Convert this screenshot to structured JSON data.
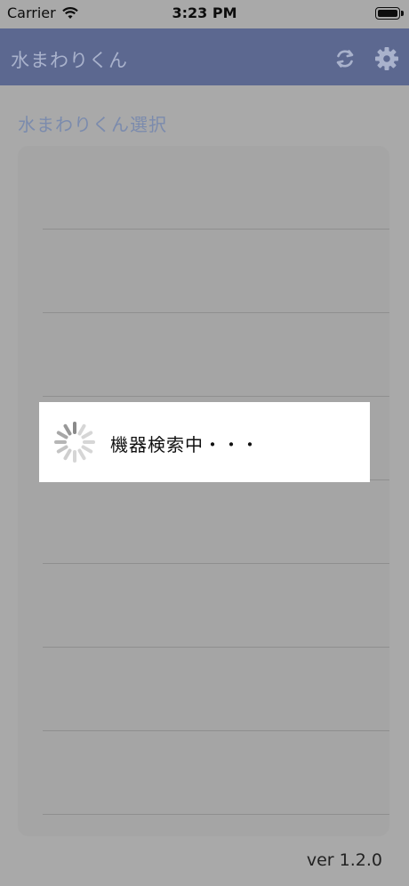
{
  "status_bar": {
    "carrier": "Carrier",
    "time": "3:23 PM"
  },
  "nav": {
    "title": "水まわりくん",
    "icons": [
      "refresh-icon",
      "gear-icon"
    ]
  },
  "section": {
    "title": "水まわりくん選択"
  },
  "device_list": {
    "rows": 9
  },
  "loading": {
    "text": "機器検索中・・・"
  },
  "footer": {
    "version": "ver 1.2.0"
  },
  "colors": {
    "nav_bar": "#5c6890",
    "overlay_background": "#a9a9a9",
    "section_title": "#7b8bad"
  }
}
